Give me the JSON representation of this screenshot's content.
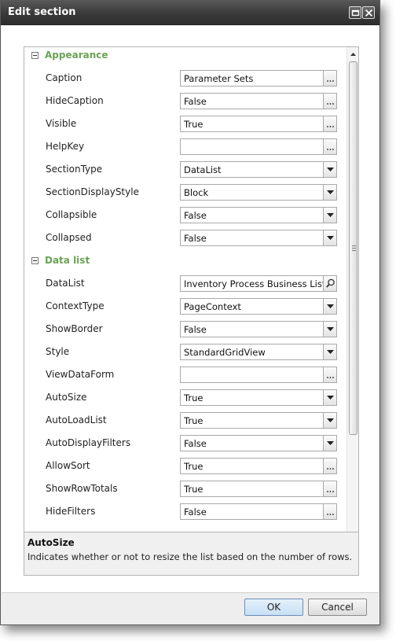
{
  "window": {
    "title": "Edit section"
  },
  "sections": [
    {
      "label": "Appearance",
      "properties": [
        {
          "name": "Caption",
          "value": "Parameter Sets",
          "editor": "ellipsis"
        },
        {
          "name": "HideCaption",
          "value": "False",
          "editor": "ellipsis"
        },
        {
          "name": "Visible",
          "value": "True",
          "editor": "ellipsis"
        },
        {
          "name": "HelpKey",
          "value": "",
          "editor": "ellipsis"
        },
        {
          "name": "SectionType",
          "value": "DataList",
          "editor": "dropdown"
        },
        {
          "name": "SectionDisplayStyle",
          "value": "Block",
          "editor": "dropdown"
        },
        {
          "name": "Collapsible",
          "value": "False",
          "editor": "dropdown"
        },
        {
          "name": "Collapsed",
          "value": "False",
          "editor": "dropdown"
        }
      ]
    },
    {
      "label": "Data list",
      "properties": [
        {
          "name": "DataList",
          "value": "Inventory Process Business List",
          "editor": "search"
        },
        {
          "name": "ContextType",
          "value": "PageContext",
          "editor": "dropdown"
        },
        {
          "name": "ShowBorder",
          "value": "False",
          "editor": "dropdown"
        },
        {
          "name": "Style",
          "value": "StandardGridView",
          "editor": "dropdown"
        },
        {
          "name": "ViewDataForm",
          "value": "",
          "editor": "ellipsis"
        },
        {
          "name": "AutoSize",
          "value": "True",
          "editor": "dropdown"
        },
        {
          "name": "AutoLoadList",
          "value": "True",
          "editor": "dropdown"
        },
        {
          "name": "AutoDisplayFilters",
          "value": "False",
          "editor": "dropdown"
        },
        {
          "name": "AllowSort",
          "value": "True",
          "editor": "ellipsis"
        },
        {
          "name": "ShowRowTotals",
          "value": "True",
          "editor": "ellipsis"
        },
        {
          "name": "HideFilters",
          "value": "False",
          "editor": "ellipsis"
        }
      ]
    }
  ],
  "description": {
    "title": "AutoSize",
    "text": "Indicates whether or not to resize the list based on the number of rows."
  },
  "buttons": {
    "ok": "OK",
    "cancel": "Cancel"
  },
  "colors": {
    "section_header": "#6aa354",
    "title_bar": "#3a3a3a",
    "ok_button": "#c7dff5"
  }
}
